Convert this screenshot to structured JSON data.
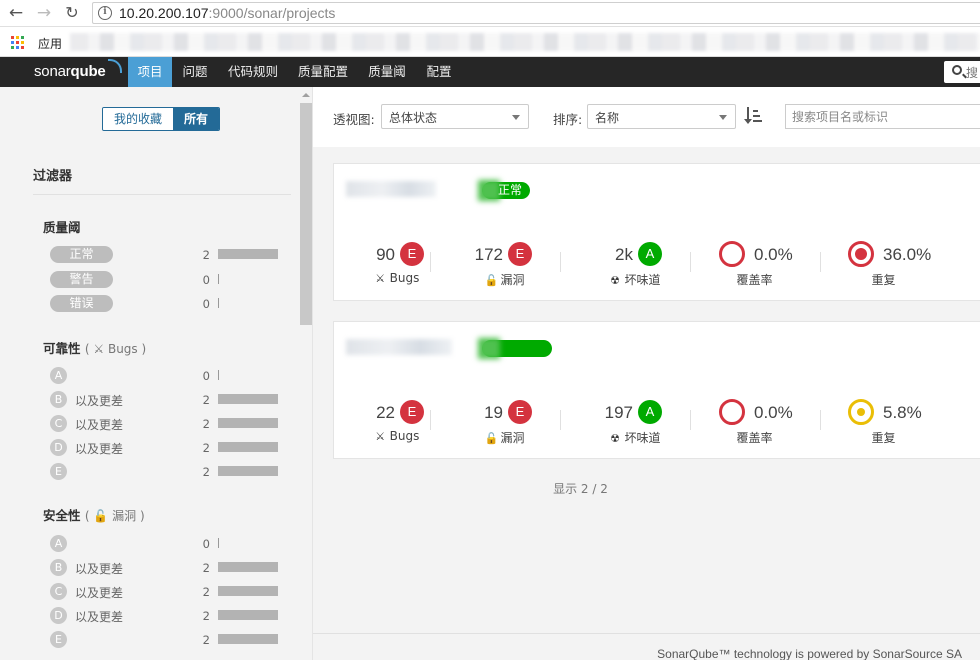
{
  "browser": {
    "host": "10.20.200.107",
    "path": ":9000/sonar/projects",
    "apps_label": "应用"
  },
  "nav": {
    "logo_a": "sonar",
    "logo_b": "qube",
    "items": [
      "项目",
      "问题",
      "代码规则",
      "质量配置",
      "质量阈",
      "配置"
    ],
    "active": "项目",
    "search_placeholder": "搜"
  },
  "sidebar": {
    "toggle": {
      "favorites": "我的收藏",
      "all": "所有"
    },
    "filters_title": "过滤器",
    "quality_gate": {
      "title": "质量阈",
      "options": [
        {
          "label": "正常",
          "count": 2
        },
        {
          "label": "警告",
          "count": 0
        },
        {
          "label": "错误",
          "count": 0
        }
      ]
    },
    "reliability": {
      "title": "可靠性",
      "sub": "Bugs",
      "options": [
        {
          "rating": "A",
          "label": "",
          "count": 0
        },
        {
          "rating": "B",
          "label": "以及更差",
          "count": 2
        },
        {
          "rating": "C",
          "label": "以及更差",
          "count": 2
        },
        {
          "rating": "D",
          "label": "以及更差",
          "count": 2
        },
        {
          "rating": "E",
          "label": "",
          "count": 2
        }
      ]
    },
    "security": {
      "title": "安全性",
      "sub": "漏洞",
      "options": [
        {
          "rating": "A",
          "label": "",
          "count": 0
        },
        {
          "rating": "B",
          "label": "以及更差",
          "count": 2
        },
        {
          "rating": "C",
          "label": "以及更差",
          "count": 2
        },
        {
          "rating": "D",
          "label": "以及更差",
          "count": 2
        },
        {
          "rating": "E",
          "label": "",
          "count": 2
        }
      ]
    }
  },
  "toolbar": {
    "perspective_label": "透视图:",
    "perspective_value": "总体状态",
    "sort_label": "排序:",
    "sort_value": "名称",
    "search_placeholder": "搜索项目名或标识"
  },
  "projects": [
    {
      "status": "正常",
      "bugs": {
        "value": "90",
        "rating": "E",
        "label": "Bugs"
      },
      "vulnerabilities": {
        "value": "172",
        "rating": "E",
        "label": "漏洞"
      },
      "code_smells": {
        "value": "2k",
        "rating": "A",
        "label": "坏味道"
      },
      "coverage": {
        "value": "0.0%",
        "label": "覆盖率"
      },
      "duplications": {
        "value": "36.0%",
        "label": "重复",
        "level": "red"
      }
    },
    {
      "status": "",
      "bugs": {
        "value": "22",
        "rating": "E",
        "label": "Bugs"
      },
      "vulnerabilities": {
        "value": "19",
        "rating": "E",
        "label": "漏洞"
      },
      "code_smells": {
        "value": "197",
        "rating": "A",
        "label": "坏味道"
      },
      "coverage": {
        "value": "0.0%",
        "label": "覆盖率"
      },
      "duplications": {
        "value": "5.8%",
        "label": "重复",
        "level": "yellow"
      }
    }
  ],
  "pagination": "显示 2 / 2",
  "footer": "SonarQube™ technology is powered by SonarSource SA",
  "colors": {
    "nav_bg": "#262626",
    "nav_active": "#4b9fd5",
    "rating_e": "#d4333f",
    "rating_a": "#00aa00",
    "status_ok": "#00aa00",
    "dup_yellow": "#eabe06"
  }
}
